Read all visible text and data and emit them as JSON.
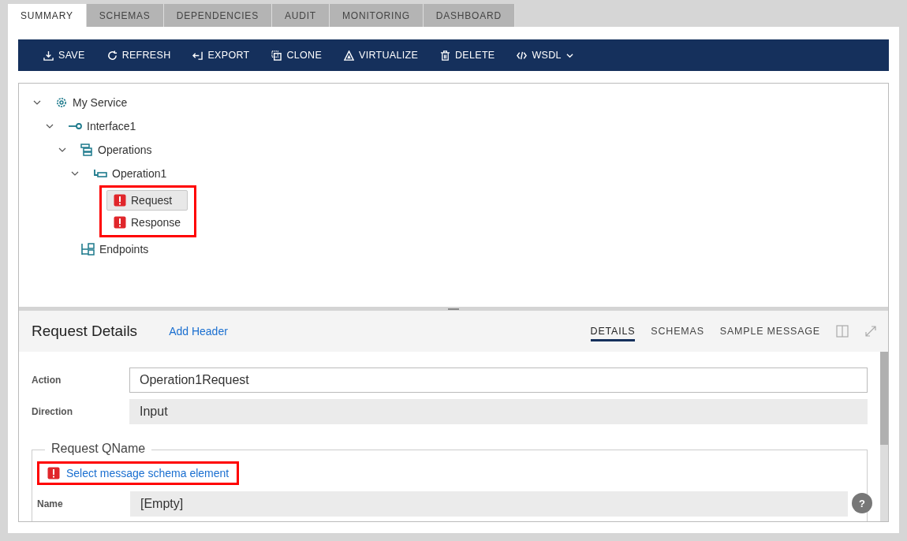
{
  "tabs": [
    {
      "label": "SUMMARY",
      "selected": true
    },
    {
      "label": "SCHEMAS",
      "selected": false
    },
    {
      "label": "DEPENDENCIES",
      "selected": false
    },
    {
      "label": "AUDIT",
      "selected": false
    },
    {
      "label": "MONITORING",
      "selected": false
    },
    {
      "label": "DASHBOARD",
      "selected": false
    }
  ],
  "toolbar": [
    {
      "kind": "save",
      "label": "SAVE"
    },
    {
      "kind": "refresh",
      "label": "REFRESH"
    },
    {
      "kind": "export",
      "label": "EXPORT"
    },
    {
      "kind": "clone",
      "label": "CLONE"
    },
    {
      "kind": "virtualize",
      "label": "VIRTUALIZE"
    },
    {
      "kind": "delete",
      "label": "DELETE"
    },
    {
      "kind": "wsdl",
      "label": "WSDL",
      "dropdown": true
    }
  ],
  "tree": [
    {
      "kind": "service",
      "label": "My Service",
      "expanded": true,
      "children": [
        {
          "kind": "interface",
          "label": "Interface1",
          "expanded": true,
          "children": [
            {
              "kind": "operations",
              "label": "Operations",
              "expanded": true,
              "children": [
                {
                  "kind": "operation",
                  "label": "Operation1",
                  "expanded": true,
                  "highlight_children": true,
                  "children": [
                    {
                      "kind": "message",
                      "label": "Request",
                      "error": true,
                      "selected": true
                    },
                    {
                      "kind": "message",
                      "label": "Response",
                      "error": true,
                      "selected": false
                    }
                  ]
                }
              ]
            },
            {
              "kind": "endpoints",
              "label": "Endpoints"
            }
          ]
        }
      ]
    }
  ],
  "details": {
    "title": "Request Details",
    "link": "Add Header",
    "tabs": [
      {
        "label": "DETAILS",
        "selected": true
      },
      {
        "label": "SCHEMAS",
        "selected": false
      },
      {
        "label": "SAMPLE MESSAGE",
        "selected": false
      }
    ],
    "fields": [
      {
        "label": "Action",
        "value": "Operation1Request",
        "editable": true
      },
      {
        "label": "Direction",
        "value": "Input",
        "editable": false
      }
    ],
    "qname": {
      "legend": "Request QName",
      "error_link": "Select message schema element",
      "error": true,
      "highlight": true,
      "fields": [
        {
          "label": "Name",
          "value": "[Empty]",
          "editable": false
        }
      ]
    }
  },
  "help": "?"
}
